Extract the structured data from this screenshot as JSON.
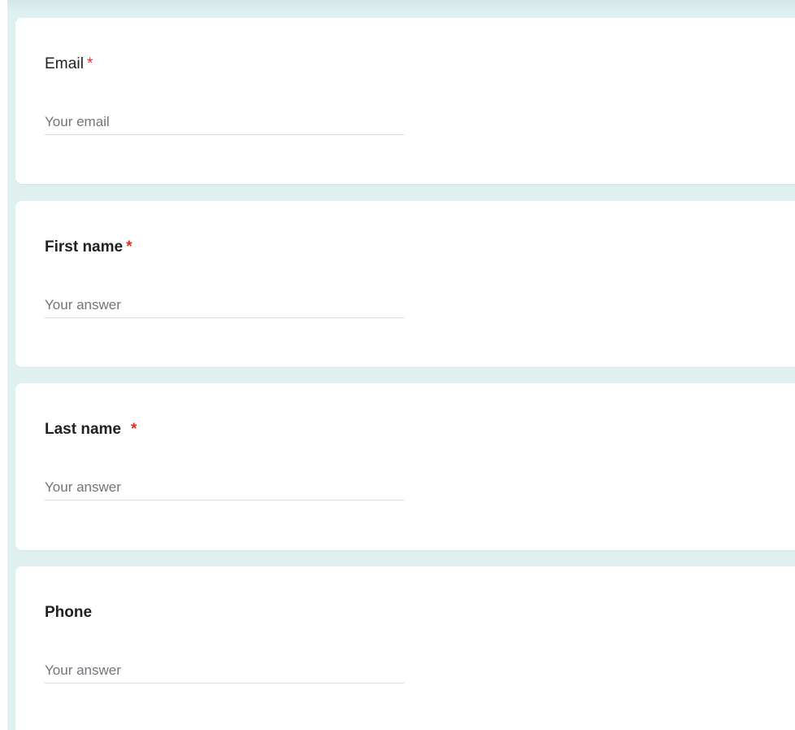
{
  "form": {
    "questions": [
      {
        "title": "Email",
        "required_mark": "*",
        "placeholder": "Your email",
        "value": ""
      },
      {
        "title": "First name",
        "required_mark": "*",
        "placeholder": "Your answer",
        "value": ""
      },
      {
        "title": "Last name",
        "required_mark": "*",
        "placeholder": "Your answer",
        "value": ""
      },
      {
        "title": "Phone",
        "required_mark": "",
        "placeholder": "Your answer",
        "value": ""
      }
    ]
  },
  "colors": {
    "page_background": "#e0eff0",
    "card_background": "#ffffff",
    "required_asterisk": "#d93025",
    "text": "#202124",
    "placeholder": "#70757a",
    "underline": "#dadce0"
  }
}
